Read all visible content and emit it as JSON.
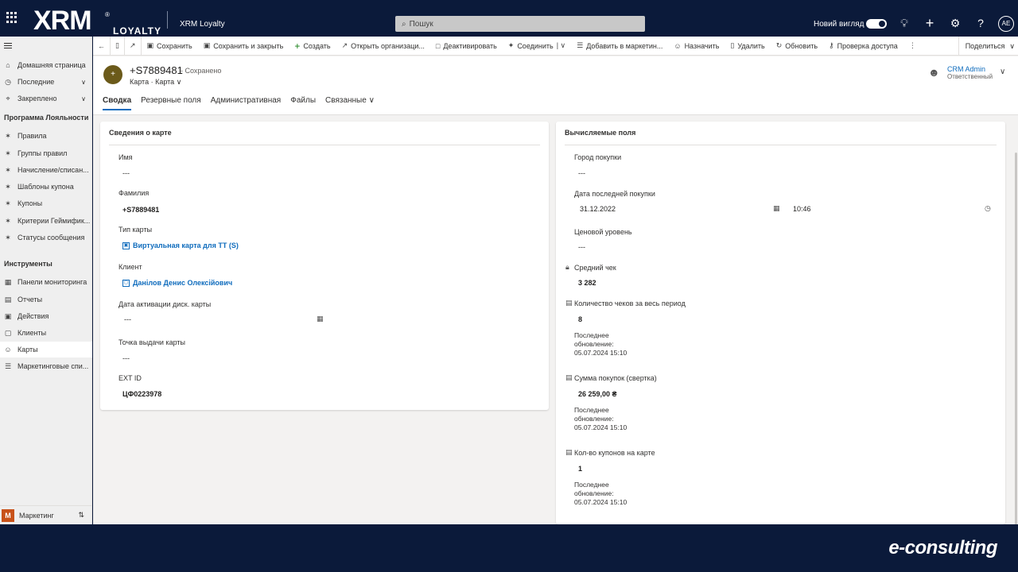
{
  "brand": {
    "logo": "XRM",
    "reg": "®",
    "sub": "LOYALTY",
    "app": "XRM Loyalty"
  },
  "header": {
    "search_placeholder": "Пошук",
    "new_look": "Новий вигляд",
    "user_initials": "AE",
    "icons": [
      "lightbulb-icon",
      "plus-icon",
      "gear-icon",
      "help-icon"
    ]
  },
  "nav": {
    "items_top": [
      {
        "label": "Домашняя страница",
        "icon": "home-icon"
      },
      {
        "label": "Последние",
        "icon": "clock-icon"
      },
      {
        "label": "Закреплено",
        "icon": "pin-icon"
      }
    ],
    "group1": "Программа Лояльности",
    "group1_items": [
      {
        "label": "Правила"
      },
      {
        "label": "Группы правил"
      },
      {
        "label": "Начисление/списан..."
      },
      {
        "label": "Шаблоны купона"
      },
      {
        "label": "Купоны"
      },
      {
        "label": "Критерии Геймифик..."
      },
      {
        "label": "Статусы сообщения"
      }
    ],
    "group2": "Инструменты",
    "group2_items": [
      {
        "label": "Панели мониторинга"
      },
      {
        "label": "Отчеты"
      },
      {
        "label": "Действия"
      },
      {
        "label": "Клиенты"
      },
      {
        "label": "Карты"
      },
      {
        "label": "Маркетинговые спи..."
      }
    ],
    "area_badge": "M",
    "area_label": "Маркетинг"
  },
  "commands": {
    "save": "Сохранить",
    "save_close": "Сохранить и закрыть",
    "create": "Создать",
    "open_org": "Открыть организаци...",
    "deactivate": "Деактивировать",
    "connect": "Соединить",
    "add_marketing": "Добавить в маркетин...",
    "assign": "Назначить",
    "delete": "Удалить",
    "refresh": "Обновить",
    "check_access": "Проверка доступа",
    "share": "Поделиться"
  },
  "record": {
    "avatar": "+",
    "title": "+S7889481",
    "saved": "- Сохранено",
    "entity": "Карта",
    "form": "Карта",
    "owner_name": "CRM Admin",
    "owner_role": "Ответственный",
    "tabs": [
      "Сводка",
      "Резервные поля",
      "Административная",
      "Файлы",
      "Связанные"
    ]
  },
  "card_info": {
    "title": "Сведения о карте",
    "name_label": "Имя",
    "name_value": "---",
    "surname_label": "Фамилия",
    "surname_value": "+S7889481",
    "card_type_label": "Тип карты",
    "card_type_value": "Виртуальная карта для ТТ (S)",
    "client_label": "Клиент",
    "client_value": "Данілов Денис Олексійович",
    "activation_label": "Дата активации диск. карты",
    "activation_value": "---",
    "issue_point_label": "Точка выдачи карты",
    "issue_point_value": "---",
    "ext_id_label": "EXT ID",
    "ext_id_value": "ЦФ0223978"
  },
  "calc": {
    "title": "Вычисляемые поля",
    "city_label": "Город покупки",
    "city_value": "---",
    "last_purchase_label": "Дата последней покупки",
    "last_purchase_date": "31.12.2022",
    "last_purchase_time": "10:46",
    "price_level_label": "Ценовой уровень",
    "price_level_value": "---",
    "avg_check_label": "Средний чек",
    "avg_check_value": "3 282",
    "checks_count_label": "Количество чеков за весь период",
    "checks_count_value": "8",
    "purchases_sum_label": "Сумма покупок (свертка)",
    "purchases_sum_value": "26 259,00 ₴",
    "coupons_label": "Кол-во купонов на карте",
    "coupons_value": "1",
    "updated_l1": "Последнее",
    "updated_l2": "обновление:",
    "updated_date": "05.07.2024 15:10"
  },
  "footer": {
    "brand": "e-consulting"
  }
}
